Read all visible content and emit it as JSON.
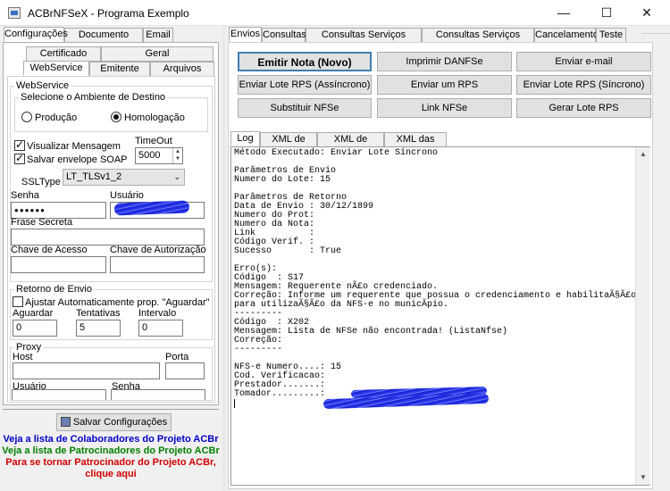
{
  "window": {
    "title": "ACBrNFSeX - Programa Exemplo",
    "controls": [
      "—",
      "☐",
      "✕"
    ]
  },
  "left": {
    "top_tabs": [
      "Configurações",
      "Documento Auxiliar",
      "Email"
    ],
    "sub_tabs_row1": [
      "Certificado",
      "Geral"
    ],
    "sub_tabs_row2": [
      "WebService",
      "Emitente",
      "Arquivos"
    ],
    "webservice": {
      "group_title": "WebService",
      "env_group_title": "Selecione o Ambiente de Destino",
      "env_options": [
        "Produção",
        "Homologação"
      ],
      "env_selected": "Homologação",
      "visualizar_label": "Visualizar Mensagem",
      "salvar_envelope_label": "Salvar envelope SOAP",
      "timeout_label": "TimeOut",
      "timeout_value": "5000",
      "ssltype_label": "SSLType",
      "ssltype_value": "LT_TLSv1_2",
      "senha_label": "Senha",
      "senha_value": "●●●●●●",
      "usuario_label": "Usuário",
      "frase_label": "Frase Secreta",
      "chave_acesso_label": "Chave de Acesso",
      "chave_autorizacao_label": "Chave de Autorização"
    },
    "retorno": {
      "group_title": "Retorno de Envio",
      "ajustar_label": "Ajustar Automaticamente prop. \"Aguardar\"",
      "aguardar_label": "Aguardar",
      "aguardar_value": "0",
      "tentativas_label": "Tentativas",
      "tentativas_value": "5",
      "intervalo_label": "Intervalo",
      "intervalo_value": "0"
    },
    "proxy": {
      "group_title": "Proxy",
      "host_label": "Host",
      "porta_label": "Porta",
      "usuario_label": "Usuário",
      "senha_label": "Senha"
    },
    "save_button": "Salvar Configurações",
    "links": {
      "colaboradores": "Veja a lista de Colaboradores do Projeto ACBr",
      "patrocinadores": "Veja a lista de Patrocinadores do Projeto ACBr",
      "patrocinador_line1": "Para se tornar Patrocinador do Projeto ACBr,",
      "patrocinador_line2": "clique aqui",
      "colors": {
        "blue": "#0000c8",
        "green": "#008000",
        "red": "#d00000"
      }
    }
  },
  "right": {
    "top_tabs": [
      "Envios",
      "Consultas",
      "Consultas Serviços Prestados",
      "Consultas Serviços Tomados",
      "Cancelamento",
      "Teste"
    ],
    "buttons": [
      [
        "Emitir Nota (Novo)",
        "Imprimir DANFSe",
        "Enviar e-mail"
      ],
      [
        "Enviar Lote RPS (Assíncrono)",
        "Enviar um RPS",
        "Enviar Lote RPS (Síncrono)"
      ],
      [
        "Substituir NFSe",
        "Link NFSe",
        "Gerar Lote RPS"
      ]
    ],
    "log_tabs": [
      "Log",
      "XML de Envio",
      "XML de Retorno",
      "XML das Notas"
    ],
    "log_lines": [
      "Método Executado: Enviar Lote Síncrono",
      "",
      "Parâmetros de Envio",
      "Numero do Lote: 15",
      "",
      "Parâmetros de Retorno",
      "Data de Envio : 30/12/1899",
      "Numero do Prot:",
      "Numero da Nota:",
      "Link          :",
      "Código Verif. :",
      "Sucesso       : True",
      "",
      "Erro(s):",
      "Código  : S17",
      "Mensagem: Requerente nÃ£o credenciado.",
      "Correção: Informe um requerente que possua o credenciamento e habilitaÃ§Ã£o",
      "para utilizaÃ§Ã£o da NFS-e no municÃ­pio.",
      "---------",
      "Código  : X202",
      "Mensagem: Lista de NFSe não encontrada! (ListaNfse)",
      "Correção:",
      "---------",
      "",
      "NFS-e Numero....: 15",
      "Cod. Verificacao:",
      "Prestador.......:",
      "Tomador.........:"
    ]
  }
}
